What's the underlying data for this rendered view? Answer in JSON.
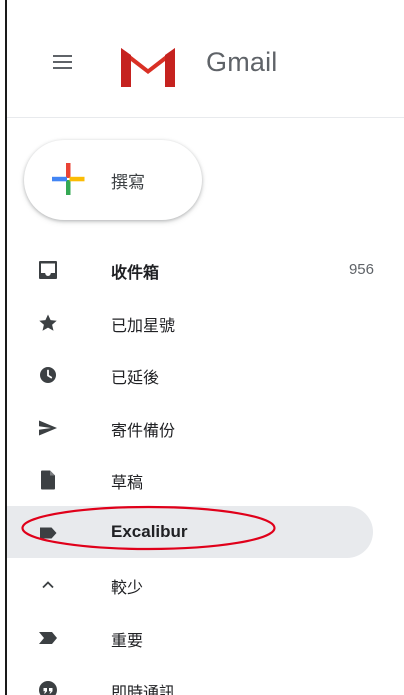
{
  "app": {
    "brand": "Gmail",
    "brand_color": "#5f6368",
    "logo_icon": "gmail-m-logo",
    "menu_icon": "hamburger-menu-icon"
  },
  "compose": {
    "label": "撰寫",
    "icon": "plus-multicolor-icon"
  },
  "nav": {
    "items": [
      {
        "label": "收件箱",
        "count": "956",
        "icon": "inbox-icon",
        "bold": true
      },
      {
        "label": "已加星號",
        "icon": "star-icon"
      },
      {
        "label": "已延後",
        "icon": "clock-icon"
      },
      {
        "label": "寄件備份",
        "icon": "send-icon"
      },
      {
        "label": "草稿",
        "icon": "draft-icon"
      },
      {
        "label": "Excalibur",
        "icon": "label-icon",
        "active": true
      },
      {
        "label": "較少",
        "icon": "chevron-up-icon"
      },
      {
        "label": "重要",
        "icon": "important-icon"
      },
      {
        "label": "即時通訊",
        "icon": "chat-icon"
      }
    ]
  },
  "colors": {
    "active_bg": "#e8eaed",
    "annotation_red": "#e0001a",
    "text": "#202124",
    "icon": "#5f6368"
  }
}
